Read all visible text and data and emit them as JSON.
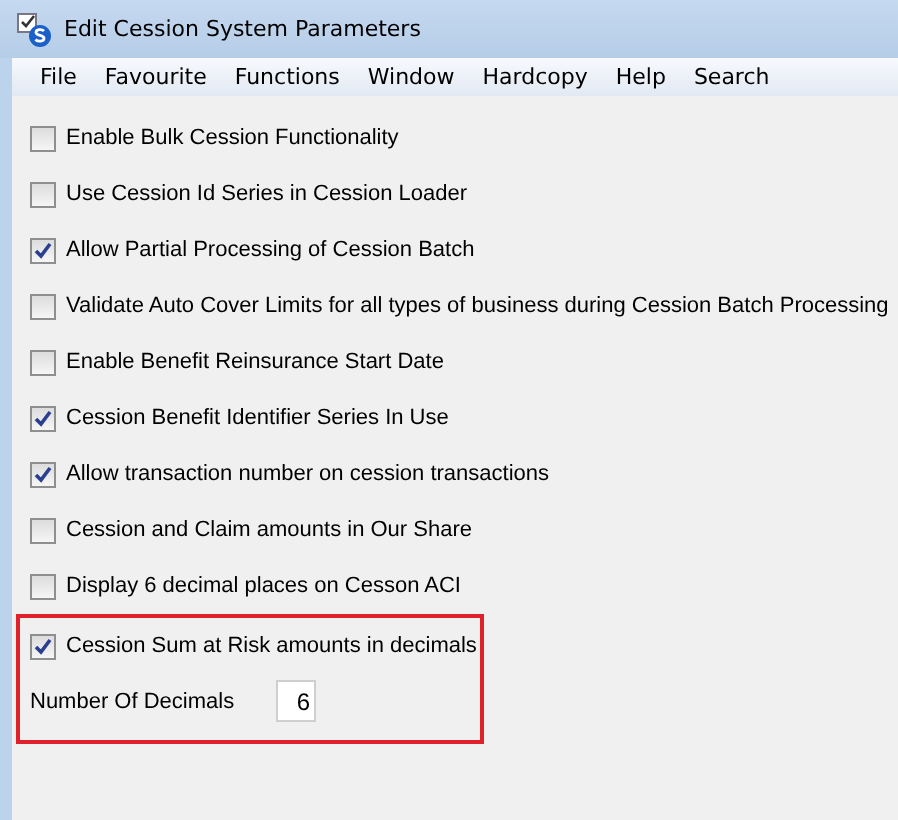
{
  "window": {
    "title": "Edit Cession System Parameters"
  },
  "menu": [
    "File",
    "Favourite",
    "Functions",
    "Window",
    "Hardcopy",
    "Help",
    "Search"
  ],
  "options": [
    {
      "label": "Enable Bulk Cession Functionality",
      "checked": false
    },
    {
      "label": "Use Cession Id Series in Cession Loader",
      "checked": false
    },
    {
      "label": "Allow Partial Processing of Cession Batch",
      "checked": true
    },
    {
      "label": "Validate Auto Cover Limits for all types of business during Cession Batch Processing",
      "checked": false
    },
    {
      "label": "Enable Benefit Reinsurance Start Date",
      "checked": false
    },
    {
      "label": "Cession Benefit Identifier Series In Use",
      "checked": true
    },
    {
      "label": "Allow transaction number on cession transactions",
      "checked": true
    },
    {
      "label": "Cession and Claim amounts in Our Share",
      "checked": false
    },
    {
      "label": "Display 6 decimal places on Cesson ACI",
      "checked": false
    }
  ],
  "highlighted_group": {
    "option": {
      "label": "Cession Sum at Risk amounts in decimals",
      "checked": true
    },
    "field": {
      "label": "Number Of Decimals",
      "value": "6"
    }
  }
}
